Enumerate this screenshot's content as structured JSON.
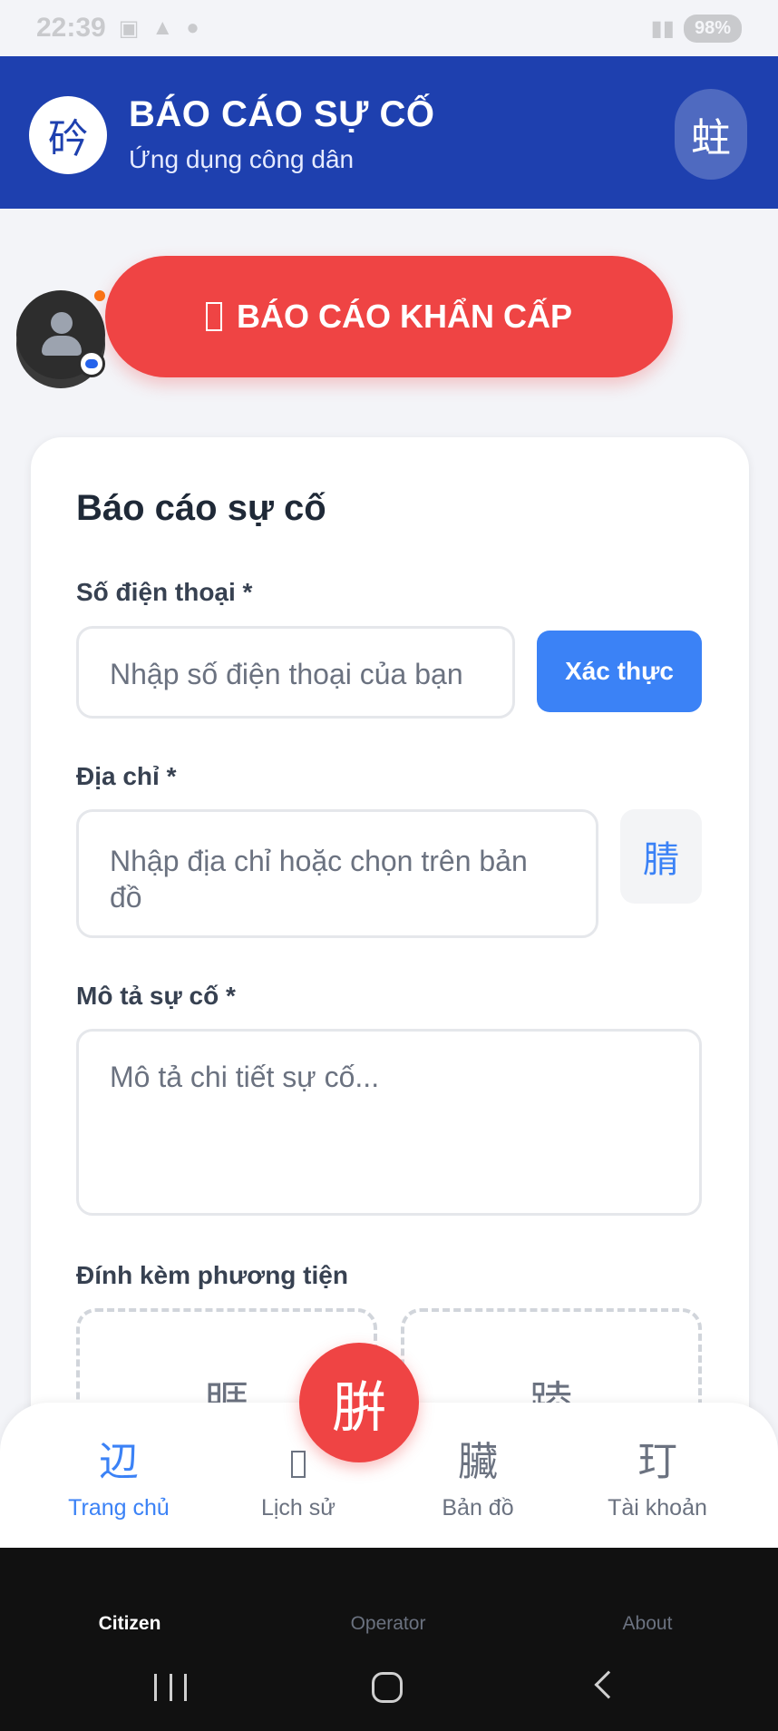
{
  "status_bar": {
    "time": "22:39",
    "battery": "98%"
  },
  "header": {
    "logo_glyph": "砛",
    "title": "BÁO CÁO SỰ CỐ",
    "subtitle": "Ứng dụng công dân",
    "action_glyph": "蛀"
  },
  "emergency": {
    "label": "BÁO CÁO KHẨN CẤP"
  },
  "form": {
    "title": "Báo cáo sự cố",
    "phone": {
      "label": "Số điện thoại *",
      "placeholder": "Nhập số điện thoại của bạn",
      "verify_label": "Xác thực"
    },
    "address": {
      "label": "Địa chỉ *",
      "placeholder": "Nhập địa chỉ hoặc chọn trên bản đồ",
      "map_glyph": "腈"
    },
    "description": {
      "label": "Mô tả sự cố *",
      "placeholder": "Mô tả chi tiết sự cố..."
    },
    "media": {
      "label": "Đính kèm phương tiện",
      "photo_glyph": "睚",
      "video_glyph": "踛"
    }
  },
  "fab": {
    "glyph": "腁"
  },
  "bottom_nav": {
    "items": [
      {
        "label": "Trang chủ",
        "glyph": "辺"
      },
      {
        "label": "Lịch sử",
        "glyph": ""
      },
      {
        "label": "Bản đồ",
        "glyph": "臟"
      },
      {
        "label": "Tài khoản",
        "glyph": "玎"
      }
    ],
    "active_index": 0
  },
  "mode_tabs": [
    "Citizen",
    "Operator",
    "About"
  ],
  "colors": {
    "header_blue": "#1e40af",
    "emergency_red": "#ef4444",
    "accent_blue": "#3b82f6"
  }
}
